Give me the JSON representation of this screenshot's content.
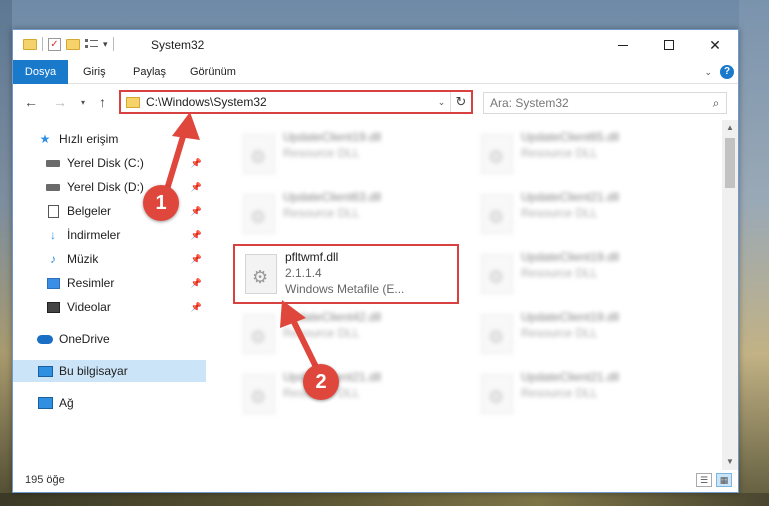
{
  "window": {
    "title": "System32"
  },
  "ribbon": {
    "tabs": [
      "Dosya",
      "Giriş",
      "Paylaş",
      "Görünüm"
    ]
  },
  "address": {
    "path": "C:\\Windows\\System32",
    "search_placeholder": "Ara: System32"
  },
  "sidebar": {
    "items": [
      {
        "label": "Hızlı erişim",
        "icon": "star-icon",
        "pinned": false
      },
      {
        "label": "Yerel Disk (C:)",
        "icon": "drive-icon",
        "pinned": true
      },
      {
        "label": "Yerel Disk (D:)",
        "icon": "drive-icon",
        "pinned": true
      },
      {
        "label": "Belgeler",
        "icon": "document-icon",
        "pinned": true
      },
      {
        "label": "İndirmeler",
        "icon": "download-icon",
        "pinned": true
      },
      {
        "label": "Müzik",
        "icon": "music-icon",
        "pinned": true
      },
      {
        "label": "Resimler",
        "icon": "picture-icon",
        "pinned": true
      },
      {
        "label": "Videolar",
        "icon": "video-icon",
        "pinned": true
      },
      {
        "label": "OneDrive",
        "icon": "cloud-icon",
        "pinned": false
      },
      {
        "label": "Bu bilgisayar",
        "icon": "computer-icon",
        "pinned": false,
        "selected": true
      },
      {
        "label": "Ağ",
        "icon": "network-icon",
        "pinned": false
      }
    ]
  },
  "files": [
    {
      "name": "UpdateClient19.dll",
      "line2": "Resource DLL",
      "line3": "",
      "blurred": true
    },
    {
      "name": "UpdateClient65.dll",
      "line2": "Resource DLL",
      "line3": "",
      "blurred": true
    },
    {
      "name": "UpdateClient63.dll",
      "line2": "Resource DLL",
      "line3": "",
      "blurred": true
    },
    {
      "name": "UpdateClient21.dll",
      "line2": "Resource DLL",
      "line3": "",
      "blurred": true
    },
    {
      "name": "pfltwmf.dll",
      "line2": "2.1.1.4",
      "line3": "Windows Metafile (E...",
      "blurred": false
    },
    {
      "name": "UpdateClient19.dll",
      "line2": "Resource DLL",
      "line3": "",
      "blurred": true
    },
    {
      "name": "UpdateClient42.dll",
      "line2": "Resource DLL",
      "line3": "",
      "blurred": true
    },
    {
      "name": "UpdateClient19.dll",
      "line2": "Resource DLL",
      "line3": "",
      "blurred": true
    },
    {
      "name": "UpdateClient21.dll",
      "line2": "Resource DLL",
      "line3": "",
      "blurred": true
    },
    {
      "name": "UpdateClient21.dll",
      "line2": "Resource DLL",
      "line3": "",
      "blurred": true
    }
  ],
  "status": {
    "count": "195 öğe"
  },
  "annotations": {
    "marker1": "1",
    "marker2": "2",
    "color": "#e0473c"
  }
}
